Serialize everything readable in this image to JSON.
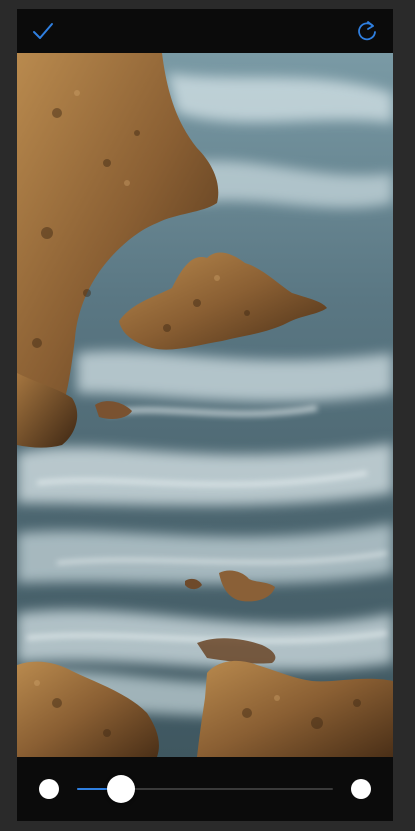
{
  "toolbar": {
    "confirm_icon": "checkmark-icon",
    "rotate_icon": "rotate-clockwise-icon",
    "accent_color": "#2f7fe0"
  },
  "image": {
    "subject": "rocky-coastline-long-exposure"
  },
  "slider": {
    "value": 0.17,
    "fill_color": "#2f7fe0",
    "track_color": "#3a3a3a",
    "thumb_color": "#ffffff"
  }
}
